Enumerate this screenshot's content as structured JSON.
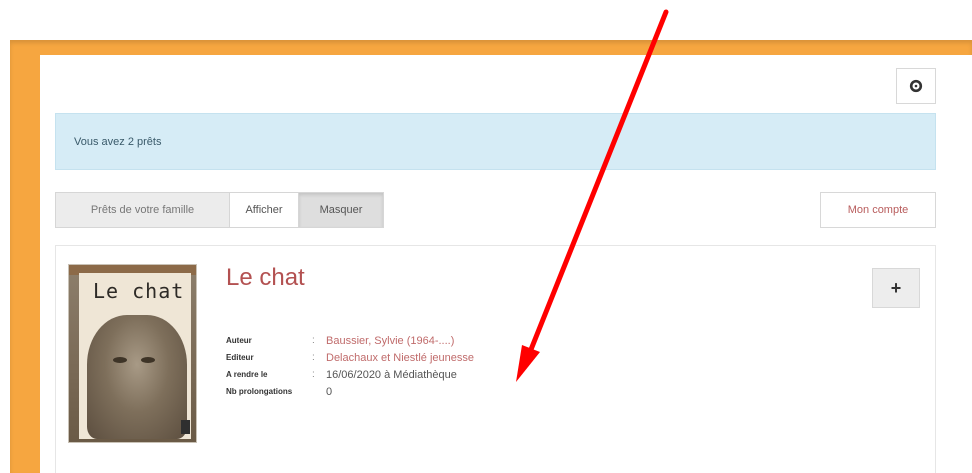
{
  "header": {
    "settings_icon": "gear-icon"
  },
  "alert": {
    "text": "Vous avez 2 prêts"
  },
  "family": {
    "label": "Prêts de votre famille",
    "show_label": "Afficher",
    "hide_label": "Masquer"
  },
  "account": {
    "label": "Mon compte"
  },
  "loan": {
    "title": "Le chat",
    "cover_title": "Le chat",
    "expand_label": "+",
    "fields": [
      {
        "key": "Auteur",
        "sep": ":",
        "value": "Baussier, Sylvie (1964-....)"
      },
      {
        "key": "Editeur",
        "sep": ":",
        "value": "Delachaux et Niestlé jeunesse"
      },
      {
        "key": "A rendre le",
        "sep": ":",
        "value": "16/06/2020 à Médiathèque"
      },
      {
        "key": "Nb prolongations",
        "sep": "",
        "value": "0"
      }
    ]
  },
  "colors": {
    "frame": "#f6a640",
    "alert_bg": "#d6ecf6",
    "link": "#b35151",
    "arrow": "#ff0000"
  }
}
